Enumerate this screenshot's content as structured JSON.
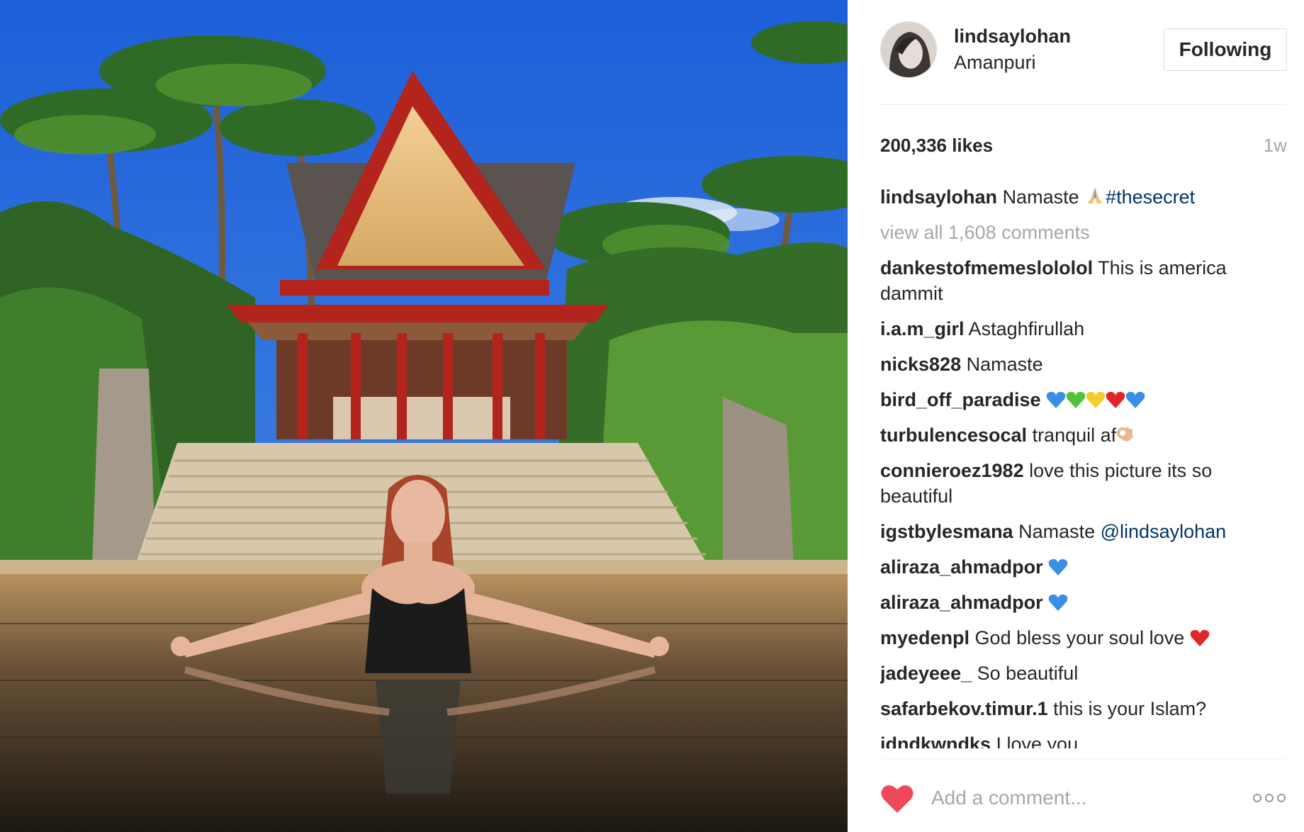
{
  "post": {
    "username": "lindsaylohan",
    "location": "Amanpuri",
    "follow_label": "Following",
    "likes": "200,336 likes",
    "time_ago": "1w",
    "caption": {
      "author": "lindsaylohan",
      "text": "Namaste ",
      "hashtag": "#thesecret"
    },
    "view_all": "view all 1,608 comments"
  },
  "comments": [
    {
      "author": "dankestofmemeslololol",
      "text": " This is america dammit"
    },
    {
      "author": "i.a.m_girl",
      "text": " Astaghfirullah"
    },
    {
      "author": "nicks828",
      "text": " Namaste"
    },
    {
      "author": "bird_off_paradise",
      "text": " "
    },
    {
      "author": "turbulencesocal",
      "text": " tranquil af"
    },
    {
      "author": "connieroez1982",
      "text": " love this picture its so beautiful"
    },
    {
      "author": "igstbylesmana",
      "text": " Namaste ",
      "mention": "@lindsaylohan"
    },
    {
      "author": "aliraza_ahmadpor",
      "text": " "
    },
    {
      "author": "aliraza_ahmadpor",
      "text": " "
    },
    {
      "author": "myedenpl",
      "text": " God bless your soul love "
    },
    {
      "author": "jadeyeee_",
      "text": " So beautiful"
    },
    {
      "author": "safarbekov.timur.1",
      "text": " this is your Islam?"
    },
    {
      "author": "idndkwndks",
      "text": " I love you"
    }
  ],
  "footer": {
    "comment_placeholder": "Add a comment..."
  },
  "colors": {
    "link": "#003569",
    "muted": "#a5a7aa",
    "heart": "#ed4956"
  },
  "icons": [
    "heart-icon",
    "more-options-icon",
    "folded-hands-emoji",
    "blue-heart-emoji",
    "green-heart-emoji",
    "yellow-heart-emoji",
    "red-heart-emoji",
    "ok-hand-emoji"
  ]
}
